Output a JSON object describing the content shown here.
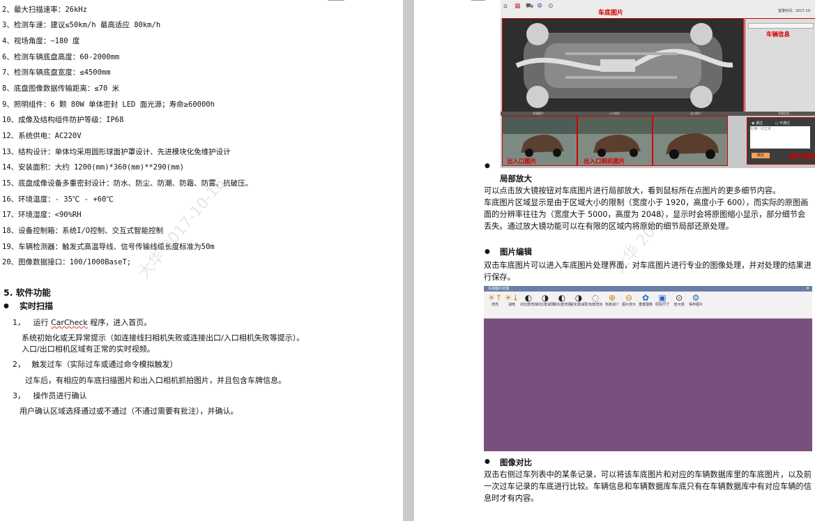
{
  "left_page": {
    "specs": [
      "2、最大扫描速率：26kHz",
      "3、检测车速：建议≤50km/h 最高适应 80km/h",
      "4、视场角度：~180 度",
      "6、检测车辆底盘高度：60-2000mm",
      "7、检测车辆底盘宽度：≤4500mm",
      "8、底盘图像数据传输距离：≤70 米",
      "9、照明组件：6 颗 80W 单体密封 LED 面光源；寿命≥60000h",
      "10、成像及结构组件防护等级：IP68",
      "12、系统供电：AC220V",
      "13、结构设计：单体均采用圆形球面护罩设计、先进模块化免维护设计",
      "14、安装面积：大约 1200(mm)*360(mm)**290(mm)",
      "15、底盘成像设备多重密封设计：防水、防尘、防潮、防霜、防雾、抗破压。",
      "16、环境温度：- 35℃ - +60℃",
      "17、环境湿度：<90%RH",
      "18、设备控制箱：系统I/O控制、交互式智能控制",
      "19、车辆检测器：触发式高温导线、信号传输线缆长度标准为50m",
      "20、图像数据接口：100/1000BaseT;"
    ],
    "section_title": "5.  软件功能",
    "subsection": "实时扫描",
    "steps": [
      {
        "num": "1，",
        "title_pre": "运行 ",
        "title_app": "CarCheck",
        "title_post": " 程序，进入首页。",
        "lines": [
          "系统初始化或无异常提示（如连接线扫相机失败或连接出口/入口相机失败等提示）。",
          "入口/出口相机区域有正常的实时视频。"
        ]
      },
      {
        "num": "2，",
        "title": "触发过车（实际过车或通过命令模拟触发）",
        "lines": [
          "过车后，有相应的车底扫描图片和出入口相机抓拍图片，并且包含车牌信息。"
        ]
      },
      {
        "num": "3，",
        "title": "操作员进行确认",
        "lines": [
          "用户确认区域选择通过或不通过（不通过需要有批注），并确认。"
        ]
      }
    ],
    "watermark": "大华  2017-10-16"
  },
  "right_page": {
    "screenshot1": {
      "label_main": "车底图片",
      "label_info": "车辆信息",
      "label_thumb1": "出入口图片",
      "label_thumb2": "出入口相机图片",
      "label_confirm": "操作员确认",
      "topbar_text": "登录时间：2017-10",
      "opt_pass": "通过",
      "opt_fail": "不通过",
      "note_placeholder": "车辆一切正常",
      "confirm_btn": "确定",
      "strip_labels": [
        "车辆图片",
        "入口照片",
        "出口照片",
        "车牌信息"
      ]
    },
    "sections": [
      {
        "title": "局部放大",
        "paragraphs": [
          "可以点击放大镜按钮对车底图片进行局部放大，看到鼠标所在点图片的更多细节内容。",
          "车底图片区域显示是由于区域大小的限制（宽度小于 1920，高度小于 600），而实际的原图画面的分辨率往往为（宽度大于 5000，高度为 2048），显示时会将原图缩小显示，部分细节会丢失。通过放大镜功能可以在有限的区域内将原始的细节局部还原处理。"
        ]
      },
      {
        "title": "图片编辑",
        "paragraphs": [
          "双击车底图片可以进入车底图片处理界面，对车底图片进行专业的图像处理，并对处理的结果进行保存。"
        ]
      },
      {
        "title": "图像对比",
        "paragraphs": [
          "双击右侧过车列表中的某条记录，可以将该车底图片和对应的车辆数据库里的车底图片，以及前一次过车记录的车底进行比较。车辆信息和车辆数据库车底只有在车辆数据库中有对应车辆的信息时才有内容。"
        ]
      }
    ],
    "editor": {
      "window_title": "车底图片处理",
      "tools": [
        {
          "icon": "brightness-up-icon",
          "glyph": "☀↑",
          "label": "增亮"
        },
        {
          "icon": "brightness-down-icon",
          "glyph": "☀↓",
          "label": "减暗"
        },
        {
          "icon": "contrast-up-icon",
          "glyph": "◐",
          "label": "对比度增强"
        },
        {
          "icon": "contrast-down-icon",
          "glyph": "◑",
          "label": "对比度减弱"
        },
        {
          "icon": "sharpen-up-icon",
          "glyph": "◐",
          "label": "锐化度增强"
        },
        {
          "icon": "sharpen-down-icon",
          "glyph": "◑",
          "label": "锐化度减弱"
        },
        {
          "icon": "saturation-icon",
          "glyph": "◌",
          "label": "色度增加"
        },
        {
          "icon": "zoom-in-icon",
          "glyph": "⊕",
          "label": "色度减少"
        },
        {
          "icon": "zoom-out-icon",
          "glyph": "⊖",
          "label": "图片放大"
        },
        {
          "icon": "restore-icon",
          "glyph": "✿",
          "label": "重置图像"
        },
        {
          "icon": "fit-icon",
          "glyph": "▣",
          "label": "原始尺寸"
        },
        {
          "icon": "magnifier-icon",
          "glyph": "⊙",
          "label": "放大镜"
        },
        {
          "icon": "save-icon",
          "glyph": "⚙",
          "label": "保存图片"
        }
      ]
    },
    "watermark": "大华  2017"
  }
}
